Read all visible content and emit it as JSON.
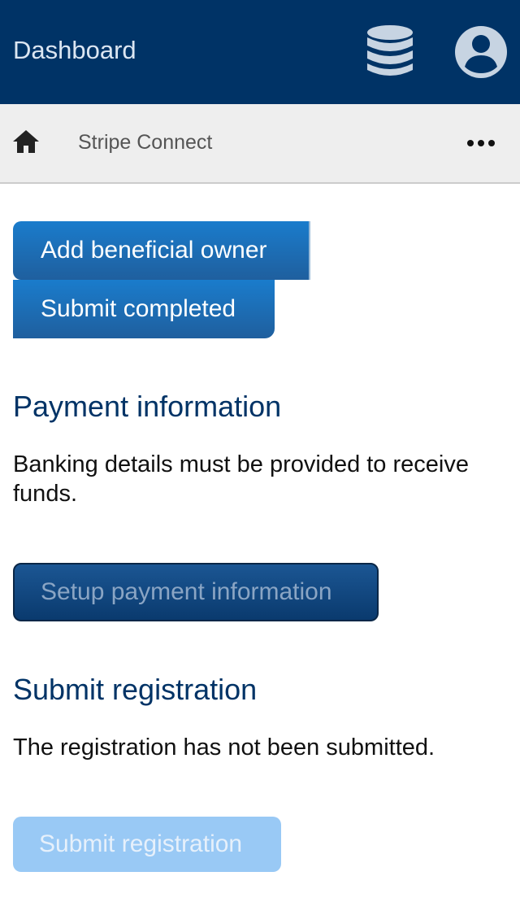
{
  "app_bar": {
    "title": "Dashboard",
    "database_icon": "database-icon",
    "account_icon": "account-circle-icon"
  },
  "breadcrumb": {
    "home_icon": "home-icon",
    "label": "Stripe Connect",
    "more_icon": "more-horizontal-icon"
  },
  "actions": {
    "add_owner_label": "Add beneficial owner",
    "submit_completed_label": "Submit completed"
  },
  "payment": {
    "heading": "Payment information",
    "description": "Banking details must be provided to receive funds.",
    "button_label": "Setup payment information"
  },
  "registration": {
    "heading": "Submit registration",
    "description": "The registration has not been submitted.",
    "button_label": "Submit registration"
  },
  "colors": {
    "app_bar": "#003366",
    "primary_button": "#1a7ccc",
    "disabled_button": "#99c9f5",
    "heading": "#003366"
  }
}
